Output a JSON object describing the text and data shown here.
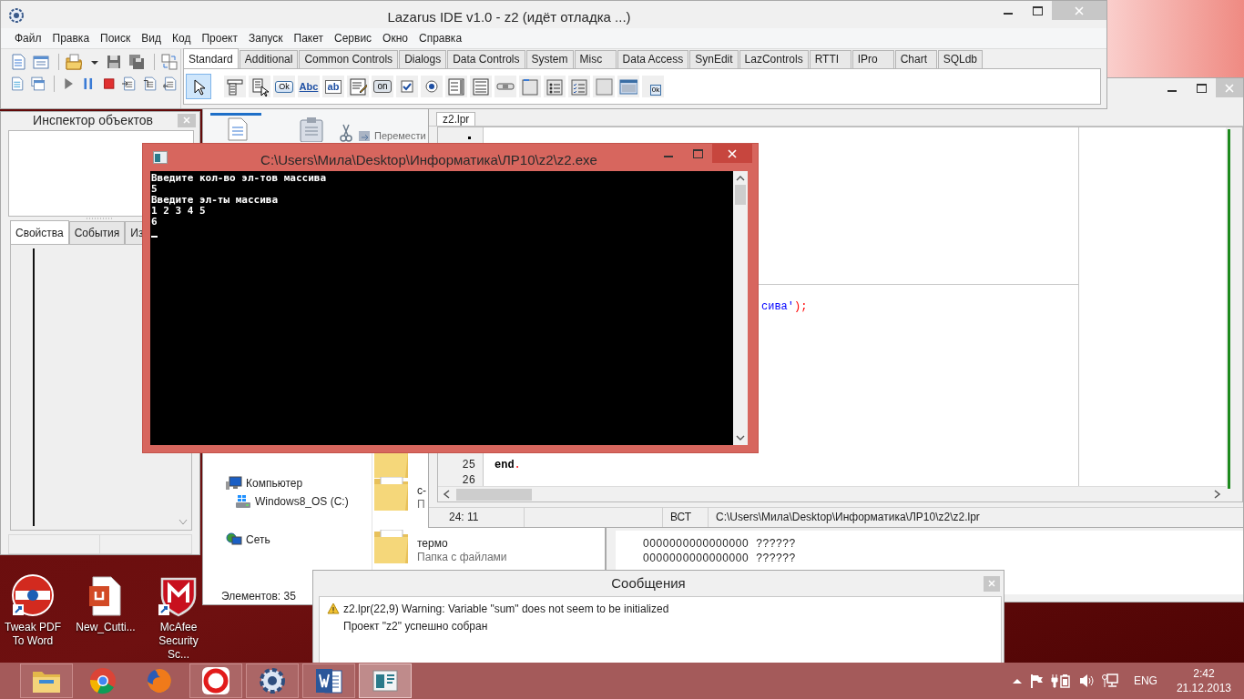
{
  "ide_window": {
    "title": "Lazarus IDE v1.0 - z2 (идёт отладка ...)",
    "menu": [
      "Файл",
      "Правка",
      "Поиск",
      "Вид",
      "Код",
      "Проект",
      "Запуск",
      "Пакет",
      "Сервис",
      "Окно",
      "Справка"
    ],
    "palette_tabs": [
      {
        "label": "Standard",
        "selected": true
      },
      {
        "label": "Additional",
        "selected": false
      },
      {
        "label": "Common Controls",
        "selected": false
      },
      {
        "label": "Dialogs",
        "selected": false
      },
      {
        "label": "Data Controls",
        "selected": false
      },
      {
        "label": "System",
        "selected": false
      },
      {
        "label": "Misc",
        "selected": false
      },
      {
        "label": "Data Access",
        "selected": false
      },
      {
        "label": "SynEdit",
        "selected": false
      },
      {
        "label": "LazControls",
        "selected": false
      },
      {
        "label": "RTTI",
        "selected": false
      },
      {
        "label": "IPro",
        "selected": false
      },
      {
        "label": "Chart",
        "selected": false
      },
      {
        "label": "SQLdb",
        "selected": false
      }
    ],
    "components": [
      {
        "kind": "pointer",
        "selected": true
      },
      {
        "kind": "mainmenu",
        "selected": false
      },
      {
        "kind": "popupmenu",
        "selected": false
      },
      {
        "kind": "button",
        "caption": "Ok",
        "selected": false
      },
      {
        "kind": "label",
        "caption": "Abc",
        "selected": false
      },
      {
        "kind": "edit",
        "caption": "ab",
        "selected": false
      },
      {
        "kind": "memo",
        "selected": false
      },
      {
        "kind": "toggle",
        "caption": "on",
        "selected": false
      },
      {
        "kind": "checkbox",
        "selected": false
      },
      {
        "kind": "radio",
        "selected": false
      },
      {
        "kind": "listbox",
        "selected": false
      },
      {
        "kind": "combobox",
        "selected": false
      },
      {
        "kind": "scrollbar",
        "selected": false
      },
      {
        "kind": "groupbox",
        "selected": false
      },
      {
        "kind": "radiogroup",
        "selected": false
      },
      {
        "kind": "checkgroup",
        "selected": false
      },
      {
        "kind": "panel",
        "selected": false
      },
      {
        "kind": "frame",
        "selected": false
      },
      {
        "kind": "actionlist",
        "caption": "0k",
        "selected": false
      }
    ]
  },
  "object_inspector": {
    "title": "Инспектор объектов",
    "tabs": [
      {
        "label": "Свойства",
        "selected": true
      },
      {
        "label": "События",
        "selected": false
      },
      {
        "label": "Из",
        "selected": false
      }
    ]
  },
  "explorer": {
    "ribbon_command": "Перемести",
    "nav": [
      {
        "label": "Компьютер",
        "kind": "computer",
        "children": [
          {
            "label": "Windows8_OS (C:)",
            "kind": "drive"
          }
        ]
      },
      {
        "label": "Сеть",
        "kind": "network"
      }
    ],
    "folders": [
      {
        "name": "с-",
        "detail": "П"
      },
      {
        "name": "термо",
        "detail": "Папка с файлами"
      }
    ],
    "status": "Элементов: 35"
  },
  "editor": {
    "tab": "z2.lpr",
    "fragment": [
      {
        "text": "сива'",
        "kind": "string"
      },
      {
        "text": ");",
        "kind": "symbol"
      }
    ],
    "lines": [
      {
        "number": "25",
        "tokens": [
          {
            "text": "end",
            "kind": "keyword"
          },
          {
            "text": ".",
            "kind": "symbol"
          }
        ]
      },
      {
        "number": "26"
      }
    ],
    "status": {
      "position": "24: 11",
      "mode": "ВСТ",
      "path": "C:\\Users\\Мила\\Desktop\\Информатика\\ЛР10\\z2\\z2.lpr"
    }
  },
  "output_panel": {
    "lines": [
      "0000000000000000  ??????",
      "0000000000000000  ??????"
    ]
  },
  "console": {
    "title": "C:\\Users\\Мила\\Desktop\\Информатика\\ЛР10\\z2\\z2.exe",
    "lines": [
      "Введите кол-во эл-тов массива",
      "5",
      "Введите эл-ты массива",
      "1 2 3 4 5",
      "6"
    ]
  },
  "messages": {
    "title": "Сообщения",
    "items": [
      {
        "kind": "warning",
        "text": "z2.lpr(22,9) Warning: Variable \"sum\" does not seem to be initialized"
      },
      {
        "kind": "info",
        "text": "Проект \"z2\" успешно собран"
      }
    ]
  },
  "desktop_icons": [
    {
      "label": "Tweak PDF To Word",
      "kind": "pdf"
    },
    {
      "label": "New_Cutti...",
      "kind": "document"
    },
    {
      "label": "McAfee Security Sc...",
      "kind": "shield"
    }
  ],
  "taskbar": {
    "apps": [
      {
        "kind": "explorer",
        "running": true,
        "selected": false
      },
      {
        "kind": "chrome",
        "running": false,
        "selected": false
      },
      {
        "kind": "firefox",
        "running": false,
        "selected": false
      },
      {
        "kind": "yandex",
        "running": true,
        "selected": false
      },
      {
        "kind": "lazarus",
        "running": true,
        "selected": false
      },
      {
        "kind": "word",
        "running": true,
        "selected": false
      },
      {
        "kind": "console",
        "running": true,
        "selected": true
      }
    ],
    "language": "ENG",
    "time": "2:42",
    "date": "21.12.2013"
  }
}
